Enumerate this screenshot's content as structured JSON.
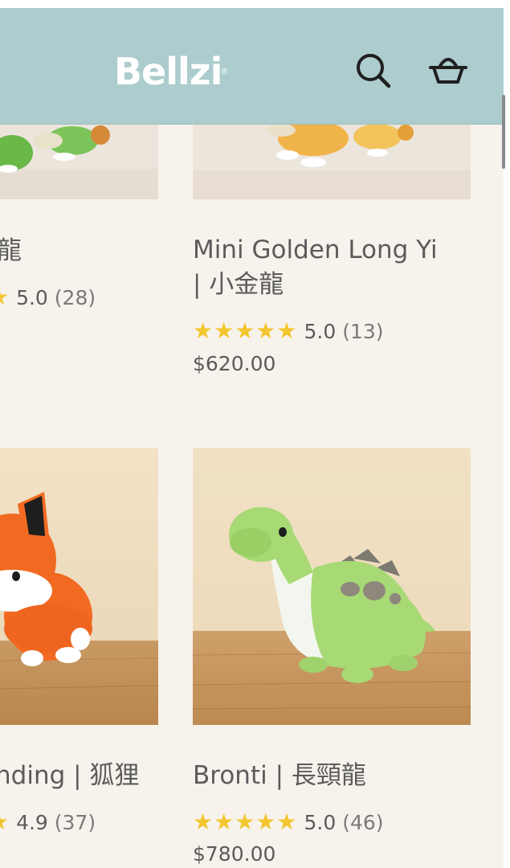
{
  "header": {
    "logo_text": "Bellzi",
    "logo_mark": "®",
    "search_icon": "search-icon",
    "cart_icon": "basket-icon",
    "background": "#accccd"
  },
  "products": [
    {
      "title_line1": "龍",
      "title_line2": "",
      "rating": "5.0",
      "count": "(28)",
      "price": ""
    },
    {
      "title_line1": "Mini Golden Long Yi",
      "title_line2": "| 小金龍",
      "stars": "★★★★★",
      "rating": "5.0",
      "count": "(13)",
      "price": "$620.00"
    },
    {
      "title_line1": "nding | 狐狸",
      "rating": "4.9",
      "count": "(37)",
      "price": ""
    },
    {
      "title_line1": "Bronti | 長頸龍",
      "stars": "★★★★★",
      "rating": "5.0",
      "count": "(46)",
      "price": "$780.00"
    }
  ],
  "colors": {
    "star": "#f3c52f",
    "page_bg": "#f7f3ec"
  }
}
